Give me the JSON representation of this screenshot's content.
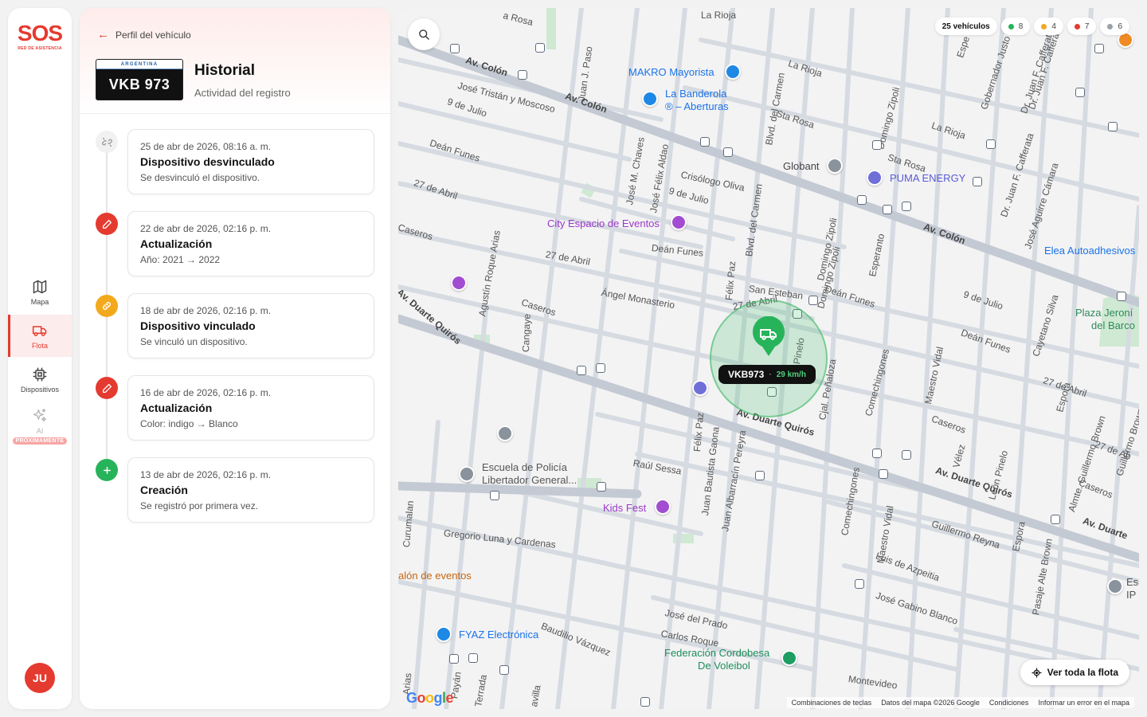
{
  "app": {
    "logo_main": "SOS",
    "logo_sub": "RED DE ASISTENCIA",
    "avatar_initials": "JU"
  },
  "nav": {
    "map": "Mapa",
    "fleet": "Flota",
    "devices": "Dispositivos",
    "ai": "AI",
    "ai_badge": "PRÓXIMAMENTE"
  },
  "history": {
    "back_label": "Perfil del vehículo",
    "plate_country": "ARGENTINA",
    "plate_number": "VKB 973",
    "title": "Historial",
    "subtitle": "Actividad del registro",
    "events": [
      {
        "date": "25 de abr de 2026, 08:16 a. m.",
        "title": "Dispositivo desvinculado",
        "desc": "Se desvinculó el dispositivo.",
        "icon": "unlink-icon",
        "color": "#f1f1f1"
      },
      {
        "date": "22 de abr de 2026, 02:16 p. m.",
        "title": "Actualización",
        "desc": "Año: 2021 → 2022",
        "icon": "pencil-icon",
        "color": "#e53a2f"
      },
      {
        "date": "18 de abr de 2026, 02:16 p. m.",
        "title": "Dispositivo vinculado",
        "desc": "Se vinculó un dispositivo.",
        "icon": "link-icon",
        "color": "#f2a91e"
      },
      {
        "date": "16 de abr de 2026, 02:16 p. m.",
        "title": "Actualización",
        "desc": "Color: indigo → Blanco",
        "icon": "pencil-icon",
        "color": "#e53a2f"
      },
      {
        "date": "13 de abr de 2026, 02:16 p. m.",
        "title": "Creación",
        "desc": "Se registró por primera vez.",
        "icon": "plus-icon",
        "color": "#27b35a"
      }
    ]
  },
  "map": {
    "stats": {
      "total": "25 vehículos",
      "green": "8",
      "yellow": "4",
      "red": "7",
      "gray": "6"
    },
    "colors": {
      "green": "#27b35a",
      "yellow": "#f2a91e",
      "red": "#e53a2f",
      "gray": "#9aa0a6"
    },
    "vehicle": {
      "plate": "VKB973",
      "speed": "29 km/h"
    },
    "fleet_button": "Ver toda la flota",
    "attribution": [
      "Combinaciones de teclas",
      "Datos del mapa ©2026 Google",
      "Condiciones",
      "Informar un error en el mapa"
    ],
    "google_logo": "Google",
    "pois": {
      "makro": "MAKRO Mayorista",
      "banderola1": "La Banderola",
      "banderola2": "® – Aberturas",
      "globant": "Globant",
      "puma": "PUMA ENERGY",
      "city": "City Espacio de Eventos",
      "elea": "Elea Autoadhesivos",
      "plaza1": "Plaza Jeroní",
      "plaza2": "del Barco",
      "escuela1": "Escuela de Policía",
      "escuela2": "Libertador General...",
      "kids": "Kids Fest",
      "salon": "alón de eventos",
      "fyaz": "FYAZ Electrónica",
      "federacion1": "Federación Cordobesa",
      "federacion2": "De Voleibol",
      "es1": "Es",
      "es2": "IP"
    },
    "streets": {
      "colon1": "Av. Colón",
      "colon2": "Av. Colón",
      "colon3": "Av. Colón",
      "tristan": "José Tristán y Moscoso",
      "julio1": "9 de Julio",
      "julio2": "9 de Julio",
      "julio3": "9 de Julio",
      "funes1": "Deán Funes",
      "funes2": "Deán Funes",
      "funes3": "Deán Funes",
      "funes4": "Deán Funes",
      "abril1": "27 de Abril",
      "abril2": "27 de Abril",
      "abril3": "27 de Abril",
      "abril4": "27 de Abril",
      "abril5": "27 de Ab",
      "caseros1": "Caseros",
      "caseros2": "Caseros",
      "caseros3": "Caseros",
      "caseros4": "Caseros",
      "quiros1": "Av. Duarte Quirós",
      "quiros2": "Av. Duarte Quirós",
      "quiros3": "Av. Duarte Quirós",
      "quiros4": "Av. Duarte",
      "monasterio": "Ángel Monasterio",
      "rioja1": "La Rioja",
      "rioja2": "La Rioja",
      "rioja3": "La Rioja",
      "rosa1": "Sta Rosa",
      "rosa2": "Sta Rosa",
      "rosa3": "a Rosa",
      "crisologo": "Crisólogo Oliva",
      "sanesteban": "San Esteban",
      "sessa": "Raúl Sessa",
      "gregorio": "Gregorio Luna y Cardenas",
      "prado": "José del Prado",
      "roque": "Carlos Roque",
      "baudilio": "Baudilio Vázquez",
      "azpeitia": "Luis de Azpeitia",
      "blanco": "José Gabino Blanco",
      "reyna": "Guillermo Reyna",
      "montevideo": "Montevideo",
      "chaves": "José M. Chaves",
      "aldao": "José Félix Aldao",
      "carmen1": "Blvd. del Carmen",
      "carmen2": "Blvd. del Carmen",
      "zipoli1": "Domingo Zipoli",
      "zipoli2": "Domingo Zipoli",
      "zipoli3": "Domingo Zipoli",
      "felixpaz1": "Félix Paz",
      "felixpaz2": "Félix Paz",
      "gaona": "Juan Bautista Gaona",
      "pereyra": "Juan Albarracín Pereyra",
      "pinelo": "Cjal. Peñaloza",
      "pinelo2": "Pinelo",
      "comechingones1": "Comechingones",
      "comechingones2": "Comechingones",
      "comechingones3": "Comechingones",
      "esperanto": "Esperanto",
      "maestro1": "Maestro Vidal",
      "maestro2": "Maestro Vidal",
      "velez": "Vélez",
      "leonpinelo": "León Pinelo",
      "espora1": "Espora",
      "espora2": "Espora",
      "guillermo": "Almte. Guillermo Brown",
      "guillermo2": "Guillermo Brown",
      "alte": "Pasaje Alte Brown",
      "cayetano": "Cayetano Silva",
      "aguirre": "José Aguirre Cámara",
      "cafferata1": "Dr. Juan F. Cafferata",
      "cafferata2": "Dr. Juan F. Cafferata",
      "cafferata3": "Dr. Juan F. Cafferat",
      "gobernador": "Gobernador Justo",
      "espe": "Espe",
      "roque2": "Agustín Roque Arias",
      "cangaye": "Cangaye",
      "juanjo": "Juan J. Paso",
      "curumalan": "Curumalan",
      "arias": "Arias",
      "payan": "Payán",
      "terrada": "Terrada",
      "ravilla": "avilla"
    }
  }
}
